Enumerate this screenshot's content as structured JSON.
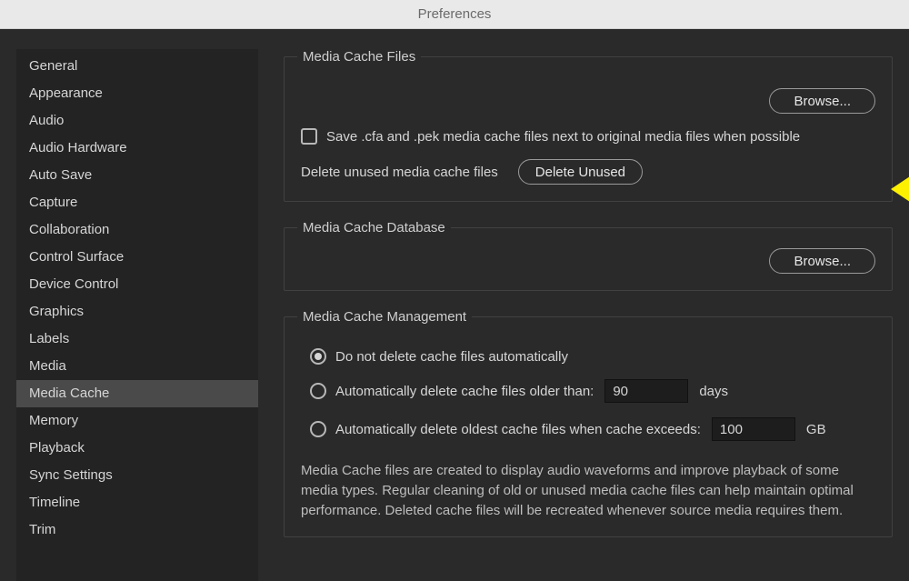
{
  "window": {
    "title": "Preferences"
  },
  "sidebar": {
    "items": [
      {
        "label": "General"
      },
      {
        "label": "Appearance"
      },
      {
        "label": "Audio"
      },
      {
        "label": "Audio Hardware"
      },
      {
        "label": "Auto Save"
      },
      {
        "label": "Capture"
      },
      {
        "label": "Collaboration"
      },
      {
        "label": "Control Surface"
      },
      {
        "label": "Device Control"
      },
      {
        "label": "Graphics"
      },
      {
        "label": "Labels"
      },
      {
        "label": "Media"
      },
      {
        "label": "Media Cache"
      },
      {
        "label": "Memory"
      },
      {
        "label": "Playback"
      },
      {
        "label": "Sync Settings"
      },
      {
        "label": "Timeline"
      },
      {
        "label": "Trim"
      }
    ],
    "selected_index": 12
  },
  "sections": {
    "cache_files": {
      "legend": "Media Cache Files",
      "browse_label": "Browse...",
      "save_next_to_original_label": "Save .cfa and .pek media cache files next to original media files when possible",
      "save_next_to_original_checked": false,
      "delete_unused_label": "Delete unused media cache files",
      "delete_unused_button": "Delete Unused"
    },
    "cache_db": {
      "legend": "Media Cache Database",
      "browse_label": "Browse..."
    },
    "cache_mgmt": {
      "legend": "Media Cache Management",
      "opt_none_label": "Do not delete cache files automatically",
      "opt_age_label": "Automatically delete cache files older than:",
      "opt_age_value": "90",
      "opt_age_unit": "days",
      "opt_size_label": "Automatically delete oldest cache files when cache exceeds:",
      "opt_size_value": "100",
      "opt_size_unit": "GB",
      "selected": "none",
      "description": "Media Cache files are created to display audio waveforms and improve playback of some media types.  Regular cleaning of old or unused media cache files can help maintain optimal performance. Deleted cache files will be recreated whenever source media requires them."
    }
  },
  "colors": {
    "accent_arrow": "#fef100"
  }
}
